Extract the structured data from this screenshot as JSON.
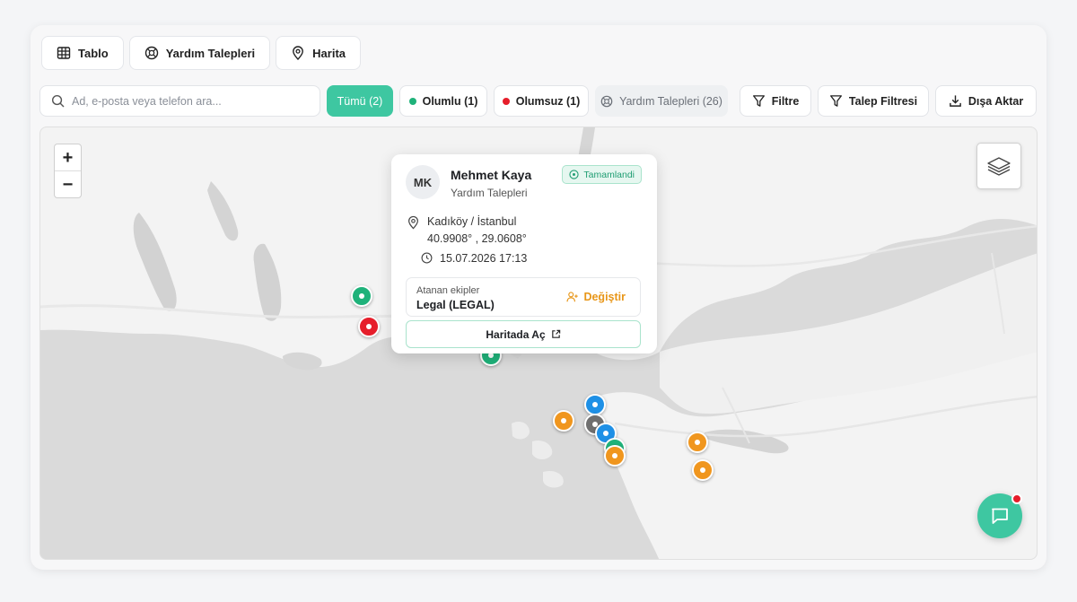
{
  "view_tabs": [
    {
      "label": "Tablo",
      "icon": "table-icon"
    },
    {
      "label": "Yardım Talepleri",
      "icon": "lifebuoy-icon"
    },
    {
      "label": "Harita",
      "icon": "map-pin-icon"
    }
  ],
  "search": {
    "placeholder": "Ad, e-posta veya telefon ara..."
  },
  "filters": {
    "all": "Tümü (2)",
    "positive": "Olumlu (1)",
    "negative": "Olumsuz (1)",
    "help_requests": "Yardım Talepleri (26)"
  },
  "actions": {
    "filter": "Filtre",
    "request_filter": "Talep Filtresi",
    "export": "Dışa Aktar"
  },
  "map": {
    "zoom_in": "+",
    "zoom_out": "−",
    "markers": [
      {
        "status": "positive"
      },
      {
        "status": "negative"
      },
      {
        "status": "positive"
      },
      {
        "status": "info"
      },
      {
        "status": "pending"
      },
      {
        "status": "neutral"
      },
      {
        "status": "info"
      },
      {
        "status": "positive"
      },
      {
        "status": "pending"
      },
      {
        "status": "pending"
      },
      {
        "status": "pending"
      }
    ]
  },
  "popup": {
    "initials": "MK",
    "name": "Mehmet Kaya",
    "category": "Yardım Talepleri",
    "status": "Tamamlandi",
    "location": "Kadıköy / İstanbul",
    "coords": "40.9908° ,  29.0608°",
    "datetime": "15.07.2026 17:13",
    "assigned_label": "Atanan ekipler",
    "assigned_value": "Legal (LEGAL)",
    "change": "Değiştir",
    "open_in_map": "Haritada Aç"
  },
  "colors": {
    "accent": "#3ec7a1",
    "positive": "#1fb27a",
    "negative": "#e61e2b",
    "info": "#1e90e6",
    "pending": "#f0961e",
    "neutral": "#6f6f6f",
    "warning": "#e89618"
  }
}
